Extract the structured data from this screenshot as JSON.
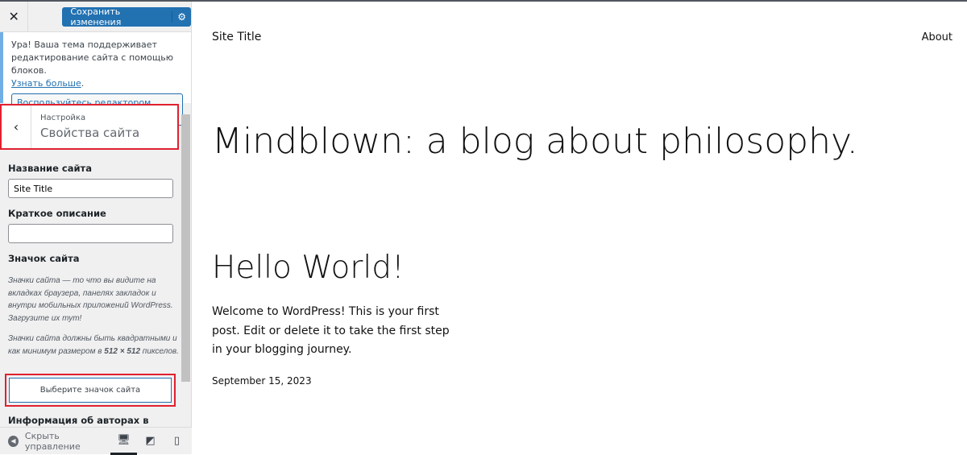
{
  "sidebar": {
    "save_label": "Сохранить изменения",
    "notice": {
      "text": "Ура! Ваша тема поддерживает редактирование сайта с помощью блоков.",
      "link": "Узнать больше",
      "button": "Воспользуйтесь редактором сайта"
    },
    "section": {
      "parent": "Настройка",
      "title": "Свойства сайта"
    },
    "site_title_label": "Название сайта",
    "site_title_value": "Site Title",
    "tagline_label": "Краткое описание",
    "tagline_value": "",
    "icon_label": "Значок сайта",
    "icon_desc1": "Значки сайта — то что вы видите на вкладках браузера, панелях закладок и внутри мобильных приложений WordPress. Загрузите их тут!",
    "icon_desc2_pre": "Значки сайта должны быть квадратными и как минимум размером в ",
    "icon_desc2_bold": "512 × 512",
    "icon_desc2_post": " пикселов.",
    "icon_button": "Выберите значок сайта",
    "next_section": "Информация об авторах в подвале",
    "hide_controls": "Скрыть управление"
  },
  "preview": {
    "site_title": "Site Title",
    "nav_about": "About",
    "tagline": "Mindblown: a blog about philosophy.",
    "post_title": "Hello World!",
    "post_text": "Welcome to WordPress! This is your first post. Edit or delete it to take the first step in your blogging journey.",
    "post_date": "September 15, 2023"
  }
}
